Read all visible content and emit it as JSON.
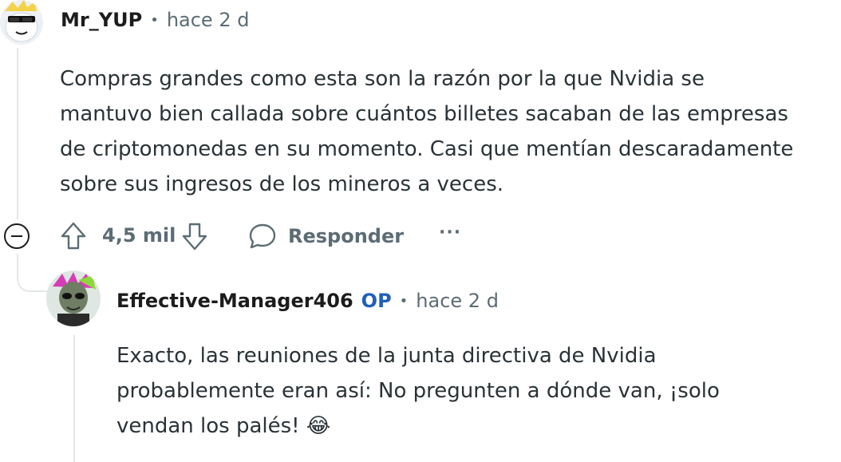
{
  "comment": {
    "username": "Mr_YUP",
    "separator": "•",
    "time": "hace 2 d",
    "body_lines": [
      "Compras grandes como esta son la razón por la que Nvidia se",
      "mantuvo bien callada sobre cuántos billetes sacaban de las empresas",
      "de criptomonedas en su momento. Casi que mentían descaradamente",
      "sobre sus ingresos de los mineros a veces."
    ],
    "vote_count": "4,5 mil",
    "reply_label": "Responder",
    "more_label": "···"
  },
  "reply": {
    "username": "Effective-Manager406",
    "op_badge": "OP",
    "separator": "•",
    "time": "hace 2 d",
    "body_lines": [
      "Exacto, las reuniones de la junta directiva de Nvidia",
      "probablemente eran así: No pregunten a dónde van, ¡solo",
      "vendan los palés! 😂"
    ]
  },
  "colors": {
    "meta": "#5c6c74",
    "op": "#1f5fb8",
    "thread_line": "#e4e7ea"
  }
}
